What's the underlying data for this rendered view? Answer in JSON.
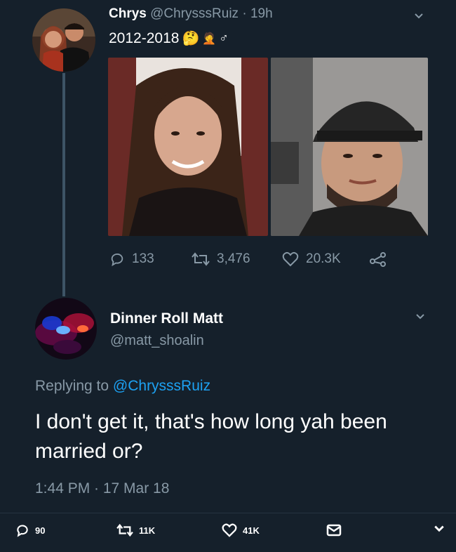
{
  "tweet": {
    "name": "Chrys",
    "handle": "@ChrysssRuiz",
    "time": "· 19h",
    "text": "2012-2018",
    "emoji_thinking": "🤔",
    "emoji_facepalm": "🤦",
    "male_sign": "♂",
    "stats": {
      "replies": "133",
      "retweets": "3,476",
      "likes": "20.3K"
    }
  },
  "reply": {
    "name": "Dinner Roll Matt",
    "handle": "@matt_shoalin",
    "replying_prefix": "Replying to",
    "replying_handle": "@ChrysssRuiz",
    "text": "I don't get it, that's how long yah been married or?",
    "timestamp": "1:44 PM · 17 Mar 18"
  },
  "bottom_bar": {
    "replies": "90",
    "retweets": "11K",
    "likes": "41K"
  },
  "colors": {
    "background": "#15202b",
    "muted": "#8899a6",
    "link": "#1da1f2",
    "thread_line": "#3d5466"
  }
}
